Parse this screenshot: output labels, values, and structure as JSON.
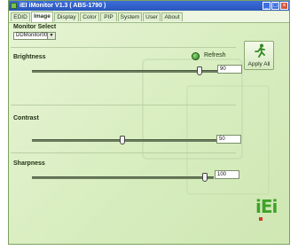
{
  "window": {
    "title": "iEI iMonitor V1.3 ( ABS-1790 )"
  },
  "tabs": [
    {
      "label": "EDID",
      "active": false
    },
    {
      "label": "Image",
      "active": true
    },
    {
      "label": "Display",
      "active": false
    },
    {
      "label": "Color",
      "active": false
    },
    {
      "label": "PIP",
      "active": false
    },
    {
      "label": "System",
      "active": false
    },
    {
      "label": "User",
      "active": false
    },
    {
      "label": "About",
      "active": false
    }
  ],
  "monitor_select": {
    "label": "Monitor Select",
    "selected": "DDMonitor00"
  },
  "buttons": {
    "refresh": "Refresh",
    "apply_all": "Apply All"
  },
  "sliders": {
    "brightness": {
      "label": "Brightness",
      "value": "90",
      "fraction": 0.9
    },
    "contrast": {
      "label": "Contrast",
      "value": "50",
      "fraction": 0.49
    },
    "sharpness": {
      "label": "Sharpness",
      "value": "100",
      "fraction": 0.95
    }
  },
  "logo": "iEi",
  "colors": {
    "background": "#dff1c8",
    "titlebar": "#2a55bd",
    "logo": "#3fa22a"
  }
}
